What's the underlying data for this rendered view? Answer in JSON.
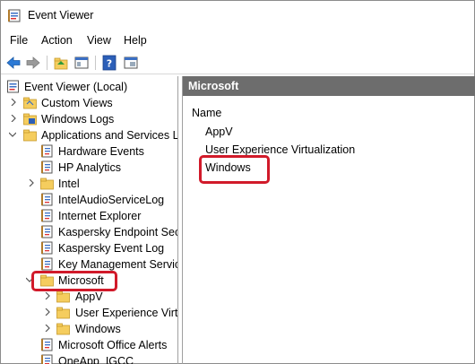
{
  "window": {
    "title": "Event Viewer"
  },
  "menu": [
    "File",
    "Action",
    "View",
    "Help"
  ],
  "toolbar": {
    "buttons": [
      "back-icon",
      "forward-icon",
      "up-folder-icon",
      "show-hide-tree-icon",
      "help-icon",
      "properties-icon"
    ]
  },
  "tree": {
    "root": "Event Viewer (Local)",
    "items": [
      {
        "label": "Custom Views",
        "icon": "folder-icon"
      },
      {
        "label": "Windows Logs",
        "icon": "logs-folder-icon"
      },
      {
        "label": "Applications and Services Lo",
        "icon": "folder-icon"
      },
      {
        "label": "Hardware Events",
        "icon": "log-icon"
      },
      {
        "label": "HP Analytics",
        "icon": "log-icon"
      },
      {
        "label": "Intel",
        "icon": "folder-icon"
      },
      {
        "label": "IntelAudioServiceLog",
        "icon": "log-icon"
      },
      {
        "label": "Internet Explorer",
        "icon": "log-icon"
      },
      {
        "label": "Kaspersky Endpoint Secu",
        "icon": "log-icon"
      },
      {
        "label": "Kaspersky Event Log",
        "icon": "log-icon"
      },
      {
        "label": "Key Management Service",
        "icon": "log-icon"
      },
      {
        "label": "Microsoft",
        "icon": "folder-icon"
      },
      {
        "label": "AppV",
        "icon": "folder-icon"
      },
      {
        "label": "User Experience Virtu",
        "icon": "folder-icon"
      },
      {
        "label": "Windows",
        "icon": "folder-icon"
      },
      {
        "label": "Microsoft Office Alerts",
        "icon": "log-icon"
      },
      {
        "label": "OneApp_IGCC",
        "icon": "log-icon"
      }
    ]
  },
  "right": {
    "header": "Microsoft",
    "column": "Name",
    "items": [
      "AppV",
      "User Experience Virtualization",
      "Windows"
    ]
  },
  "colors": {
    "highlight": "#d11a2a",
    "pane_header": "#6d6d6d",
    "folder": "#f5cd5e"
  }
}
